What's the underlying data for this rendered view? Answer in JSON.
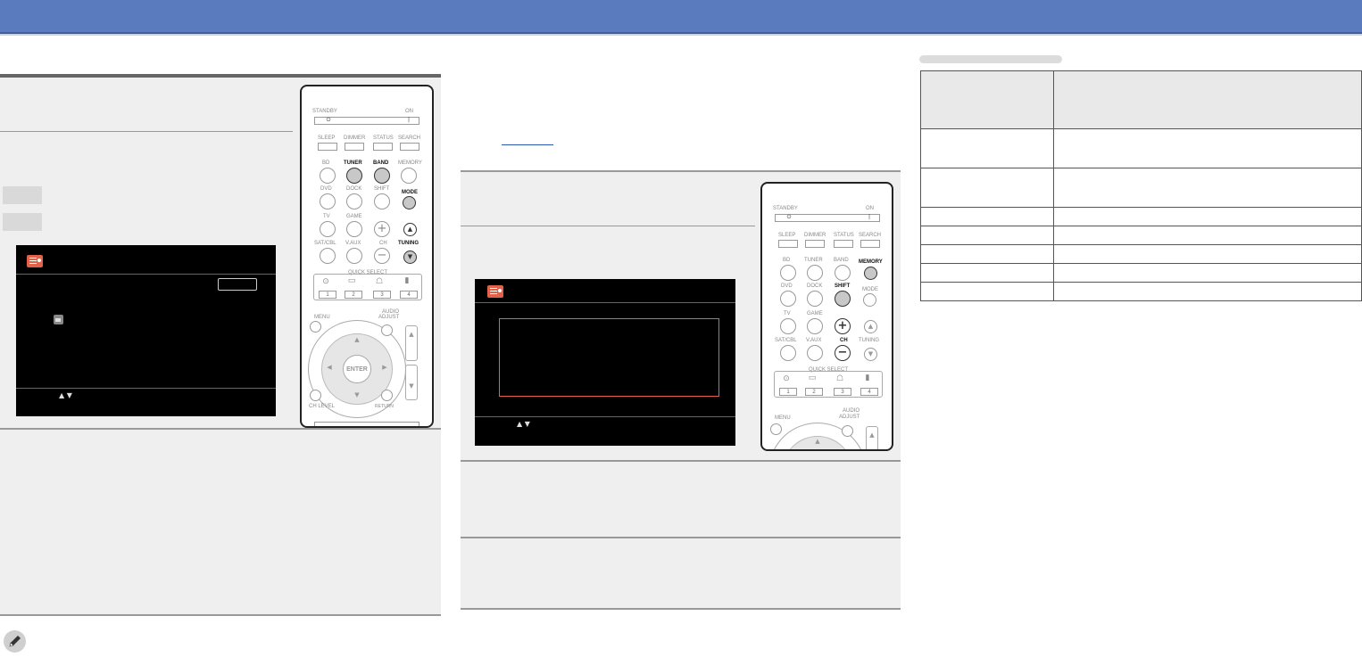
{
  "remote": {
    "standby": "STANDBY",
    "on": "ON",
    "sleep": "SLEEP",
    "dimmer": "DIMMER",
    "status": "STATUS",
    "search": "SEARCH",
    "bd": "BD",
    "tuner": "TUNER",
    "band": "BAND",
    "memory": "MEMORY",
    "dvd": "DVD",
    "dock": "DOCK",
    "shift": "SHIFT",
    "mode": "MODE",
    "tv": "TV",
    "game": "GAME",
    "sat_cbl": "SAT/CBL",
    "v_aux": "V.AUX",
    "ch": "CH",
    "tuning": "TUNING",
    "quick_select": "QUICK SELECT",
    "menu": "MENU",
    "audio": "AUDIO",
    "adjust": "ADJUST",
    "enter": "ENTER",
    "ch_level": "CH LEVEL",
    "return": "RETURN",
    "num1": "1",
    "num2": "2",
    "num3": "3",
    "num4": "4"
  },
  "icons": {
    "radio": "radio-icon",
    "pencil": "pencil-icon"
  },
  "colors": {
    "header": "#5b7bbf",
    "screen_accent": "#e0624a"
  }
}
